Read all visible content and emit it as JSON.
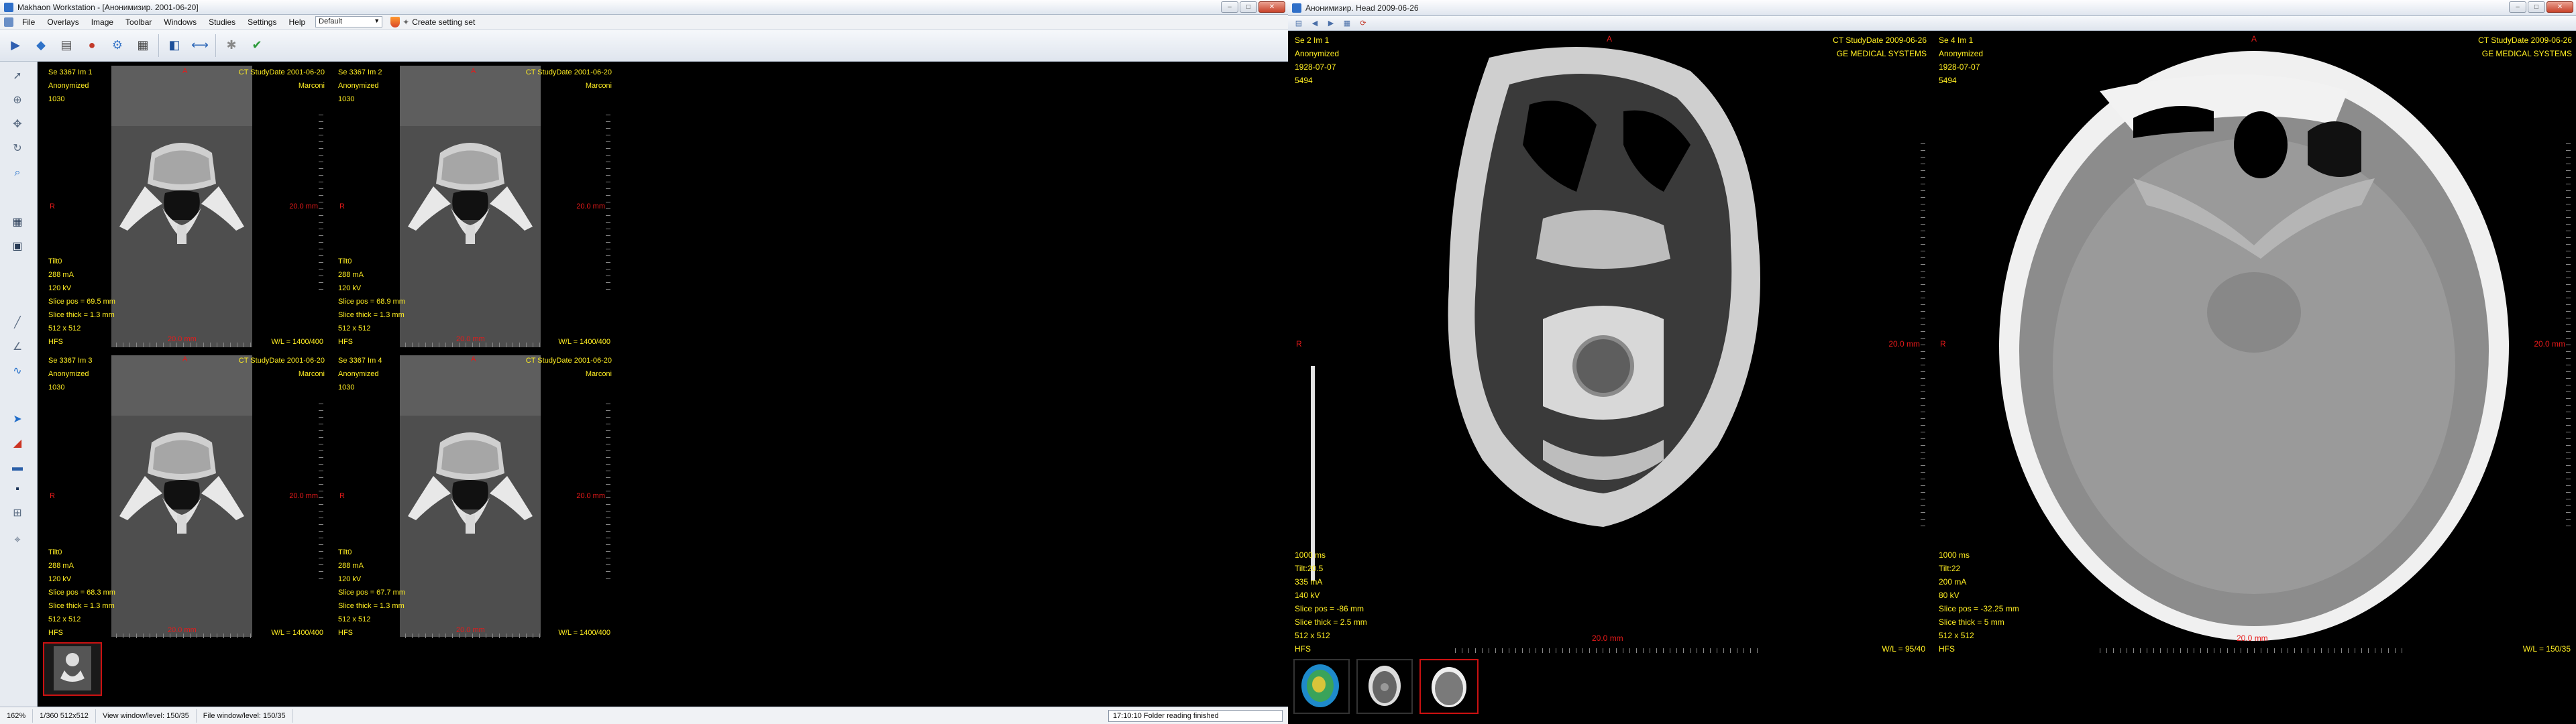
{
  "left_window": {
    "title": "Makhaon Workstation - [Анонимизир. 2001-06-20]",
    "menu": [
      "File",
      "Overlays",
      "Image",
      "Toolbar",
      "Windows",
      "Studies",
      "Settings",
      "Help"
    ],
    "preset": "Default",
    "create_setting": "Create setting set",
    "window_buttons": [
      "–",
      "□",
      "✕"
    ],
    "viewports": [
      {
        "series": "Se 3367  Im 1",
        "name": "Anonymized",
        "id": "1030",
        "study": "CT StudyDate 2001-06-20",
        "station": "Marconi",
        "orient_top": "A",
        "orient_left": "R",
        "scale": "20.0 mm",
        "bottom_scale": "20.0 mm",
        "tilt": "Tilt0",
        "ma": "288 mA",
        "kv": "120 kV",
        "pos": "Slice pos = 69.5 mm",
        "thick": "Slice thick = 1.3 mm",
        "size": "512 x 512",
        "hfs": "HFS",
        "wl": "W/L = 1400/400"
      },
      {
        "series": "Se 3367  Im 2",
        "name": "Anonymized",
        "id": "1030",
        "study": "CT StudyDate 2001-06-20",
        "station": "Marconi",
        "orient_top": "A",
        "orient_left": "R",
        "scale": "20.0 mm",
        "bottom_scale": "20.0 mm",
        "tilt": "Tilt0",
        "ma": "288 mA",
        "kv": "120 kV",
        "pos": "Slice pos = 68.9 mm",
        "thick": "Slice thick = 1.3 mm",
        "size": "512 x 512",
        "hfs": "HFS",
        "wl": "W/L = 1400/400"
      },
      {
        "series": "Se 3367  Im 3",
        "name": "Anonymized",
        "id": "1030",
        "study": "CT StudyDate 2001-06-20",
        "station": "Marconi",
        "orient_top": "A",
        "orient_left": "R",
        "scale": "20.0 mm",
        "bottom_scale": "20.0 mm",
        "tilt": "Tilt0",
        "ma": "288 mA",
        "kv": "120 kV",
        "pos": "Slice pos = 68.3 mm",
        "thick": "Slice thick = 1.3 mm",
        "size": "512 x 512",
        "hfs": "HFS",
        "wl": "W/L = 1400/400"
      },
      {
        "series": "Se 3367  Im 4",
        "name": "Anonymized",
        "id": "1030",
        "study": "CT StudyDate 2001-06-20",
        "station": "Marconi",
        "orient_top": "A",
        "orient_left": "R",
        "scale": "20.0 mm",
        "bottom_scale": "20.0 mm",
        "tilt": "Tilt0",
        "ma": "288 mA",
        "kv": "120 kV",
        "pos": "Slice pos = 67.7 mm",
        "thick": "Slice thick = 1.3 mm",
        "size": "512 x 512",
        "hfs": "HFS",
        "wl": "W/L = 1400/400"
      }
    ],
    "status": [
      "162%",
      "1/360  512x512",
      "View window/level: 150/35",
      "File window/level: 150/35"
    ],
    "progress": "17:10:10 Folder reading finished"
  },
  "right_window": {
    "title": "Анонимизир. Head 2009-06-26",
    "window_buttons": [
      "–",
      "□",
      "✕"
    ],
    "viewports": [
      {
        "series": "Se 2  Im 1",
        "name": "Anonymized",
        "dob": "1928-07-07",
        "id": "5494",
        "study": "CT StudyDate 2009-06-26",
        "station": "GE MEDICAL SYSTEMS",
        "orient_top": "A",
        "orient_left": "R",
        "scale": "20.0 mm",
        "bottom_scale": "20.0 mm",
        "ms": "1000 ms",
        "tilt": "Tilt:20.5",
        "ma": "335 mA",
        "kv": "140 kV",
        "pos": "Slice pos = -86 mm",
        "thick": "Slice thick = 2.5 mm",
        "size": "512 x 512",
        "hfs": "HFS",
        "wl": "W/L = 95/40"
      },
      {
        "series": "Se 4  Im 1",
        "name": "Anonymized",
        "dob": "1928-07-07",
        "id": "5494",
        "study": "CT StudyDate 2009-06-26",
        "station": "GE MEDICAL SYSTEMS",
        "orient_top": "A",
        "orient_left": "R",
        "scale": "20.0 mm",
        "bottom_scale": "20.0 mm",
        "ms": "1000 ms",
        "tilt": "Tilt:22",
        "ma": "200 mA",
        "kv": "80 kV",
        "pos": "Slice pos = -32.25 mm",
        "thick": "Slice thick = 5 mm",
        "size": "512 x 512",
        "hfs": "HFS",
        "wl": "W/L = 150/35"
      }
    ]
  },
  "icons": {
    "toolbar": [
      "open-icon",
      "save-icon",
      "print-icon",
      "cd-icon",
      "settings-icon",
      "layout-icon",
      "window-level-icon",
      "measure-icon",
      "check-icon"
    ],
    "sidetools": [
      "pointer-icon",
      "zoom-icon",
      "pan-icon",
      "rotate-icon",
      "magnify-icon",
      "grid-icon",
      "monitor-icon",
      "line-icon",
      "angle-icon",
      "arrow-icon",
      "roi-icon",
      "color-icon",
      "display-icon",
      "layout-2x2-icon",
      "cursor-icon"
    ]
  },
  "colors": {
    "overlay_text": "#ffee22",
    "orientation": "#e81a1a",
    "selection": "#c11111"
  }
}
